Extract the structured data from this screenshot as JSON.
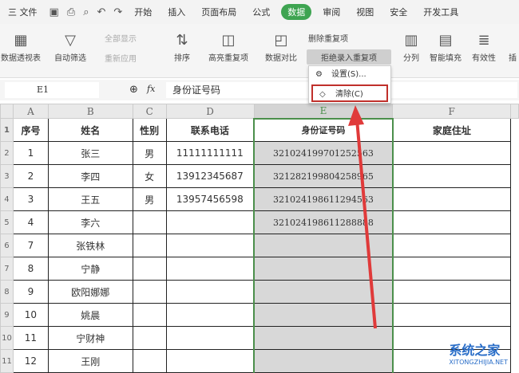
{
  "menubar": {
    "file": "三 文件",
    "tabs": [
      "开始",
      "插入",
      "页面布局",
      "公式",
      "数据",
      "审阅",
      "视图",
      "安全",
      "开发工具"
    ],
    "active": "数据"
  },
  "ribbon": {
    "pivot": "数据透视表",
    "autofilter": "自动筛选",
    "show_all": "全部显示",
    "reapply": "重新应用",
    "sort": "排序",
    "highlight_dup": "高亮重复项",
    "compare": "数据对比",
    "delete_dup": "删除重复项",
    "reject_dup": "拒绝录入重复项",
    "split": "分列",
    "smart_fill": "智能填充",
    "validity": "有效性",
    "insert": "插"
  },
  "dropdown": {
    "settings": "设置(S)...",
    "clear": "清除(C)"
  },
  "formula": {
    "cell_ref": "E1",
    "fx": "fx",
    "value": "身份证号码"
  },
  "columns": [
    "A",
    "B",
    "C",
    "D",
    "E",
    "F"
  ],
  "headers": [
    "序号",
    "姓名",
    "性别",
    "联系电话",
    "身份证号码",
    "家庭住址"
  ],
  "rows": [
    {
      "rn": "2",
      "seq": "1",
      "name": "张三",
      "sex": "男",
      "phone": "11111111111",
      "id": "321024199701252563",
      "addr": ""
    },
    {
      "rn": "3",
      "seq": "2",
      "name": "李四",
      "sex": "女",
      "phone": "13912345687",
      "id": "321282199804258965",
      "addr": ""
    },
    {
      "rn": "4",
      "seq": "3",
      "name": "王五",
      "sex": "男",
      "phone": "13957456598",
      "id": "321024198611294563",
      "addr": ""
    },
    {
      "rn": "5",
      "seq": "4",
      "name": "李六",
      "sex": "",
      "phone": "",
      "id": "321024198611288888",
      "addr": ""
    },
    {
      "rn": "6",
      "seq": "7",
      "name": "张铁林",
      "sex": "",
      "phone": "",
      "id": "",
      "addr": ""
    },
    {
      "rn": "7",
      "seq": "8",
      "name": "宁静",
      "sex": "",
      "phone": "",
      "id": "",
      "addr": ""
    },
    {
      "rn": "8",
      "seq": "9",
      "name": "欧阳娜娜",
      "sex": "",
      "phone": "",
      "id": "",
      "addr": ""
    },
    {
      "rn": "9",
      "seq": "10",
      "name": "姚晨",
      "sex": "",
      "phone": "",
      "id": "",
      "addr": ""
    },
    {
      "rn": "10",
      "seq": "11",
      "name": "宁财神",
      "sex": "",
      "phone": "",
      "id": "",
      "addr": ""
    },
    {
      "rn": "11",
      "seq": "12",
      "name": "王刚",
      "sex": "",
      "phone": "",
      "id": "",
      "addr": ""
    }
  ],
  "watermark": {
    "title": "系统之家",
    "url": "XITONGZHIJIA.NET"
  }
}
